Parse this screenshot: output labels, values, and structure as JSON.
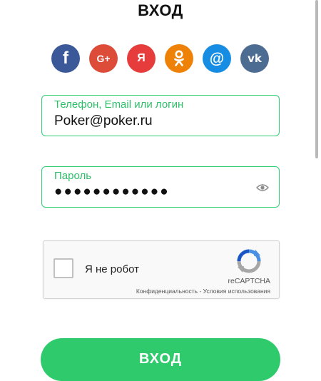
{
  "page": {
    "title": "ВХОД"
  },
  "social": [
    {
      "name": "facebook",
      "glyph": "f",
      "color": "#3b5998"
    },
    {
      "name": "google-plus",
      "glyph": "G+",
      "color": "#dd4b39"
    },
    {
      "name": "yandex",
      "glyph": "Я",
      "color": "#e63c3c"
    },
    {
      "name": "odnoklassniki",
      "glyph": "ok",
      "color": "#ee8208"
    },
    {
      "name": "mailru",
      "glyph": "@",
      "color": "#168de2"
    },
    {
      "name": "vkontakte",
      "glyph": "vk",
      "color": "#4c6c91"
    }
  ],
  "login_field": {
    "label": "Телефон, Email или логин",
    "value": "Poker@poker.ru"
  },
  "password_field": {
    "label": "Пароль",
    "value": "●●●●●●●●●●●●",
    "icon": "eye-icon"
  },
  "captcha": {
    "label": "Я не робот",
    "brand": "reCAPTCHA",
    "privacy": "Конфиденциальность",
    "separator": "-",
    "terms": "Условия использования"
  },
  "submit": {
    "label": "ВХОД"
  },
  "colors": {
    "accent": "#2fca6b"
  }
}
